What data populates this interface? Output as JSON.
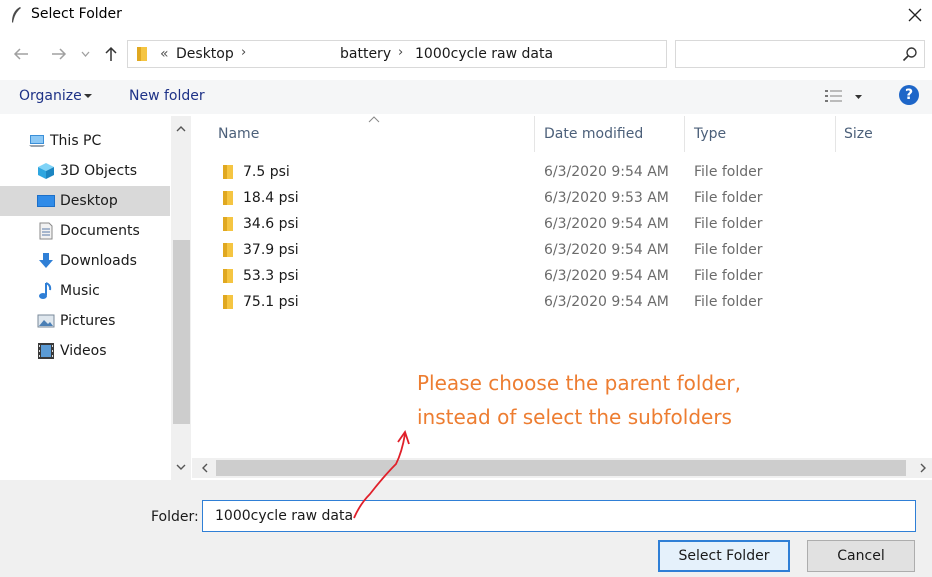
{
  "window": {
    "title": "Select Folder",
    "icon": "feather-icon",
    "close_icon": "close-icon"
  },
  "nav": {
    "back_icon": "back-arrow-icon",
    "forward_icon": "forward-arrow-icon",
    "recent_icon": "chevron-down-icon",
    "up_icon": "up-arrow-icon"
  },
  "address": {
    "overflow": "«",
    "crumbs": [
      "Desktop",
      "battery",
      "1000cycle raw data"
    ],
    "search_placeholder": ""
  },
  "toolbar": {
    "organize": "Organize",
    "new_folder": "New folder",
    "help": "?"
  },
  "sidebar": {
    "items": [
      {
        "label": "This PC",
        "icon": "computer-icon"
      },
      {
        "label": "3D Objects",
        "icon": "cube-icon"
      },
      {
        "label": "Desktop",
        "icon": "desktop-icon",
        "selected": true
      },
      {
        "label": "Documents",
        "icon": "document-icon"
      },
      {
        "label": "Downloads",
        "icon": "download-icon"
      },
      {
        "label": "Music",
        "icon": "music-note-icon"
      },
      {
        "label": "Pictures",
        "icon": "picture-icon"
      },
      {
        "label": "Videos",
        "icon": "film-icon"
      }
    ]
  },
  "files": {
    "columns": [
      "Name",
      "Date modified",
      "Type",
      "Size"
    ],
    "rows": [
      {
        "name": "7.5 psi",
        "date": "6/3/2020 9:54 AM",
        "type": "File folder"
      },
      {
        "name": "18.4 psi",
        "date": "6/3/2020 9:53 AM",
        "type": "File folder"
      },
      {
        "name": "34.6 psi",
        "date": "6/3/2020 9:54 AM",
        "type": "File folder"
      },
      {
        "name": "37.9 psi",
        "date": "6/3/2020 9:54 AM",
        "type": "File folder"
      },
      {
        "name": "53.3 psi",
        "date": "6/3/2020 9:54 AM",
        "type": "File folder"
      },
      {
        "name": "75.1 psi",
        "date": "6/3/2020 9:54 AM",
        "type": "File folder"
      }
    ]
  },
  "annotation": {
    "line1": "Please choose the parent folder,",
    "line2": "instead of select the subfolders",
    "color": "#ed7d31",
    "arrow_color": "#e0202a"
  },
  "footer": {
    "folder_label": "Folder:",
    "folder_value": "1000cycle raw data",
    "select_button": "Select Folder",
    "cancel_button": "Cancel"
  },
  "colors": {
    "accent": "#2f7fd6",
    "link": "#1e3287",
    "folder": "#f5c542"
  }
}
